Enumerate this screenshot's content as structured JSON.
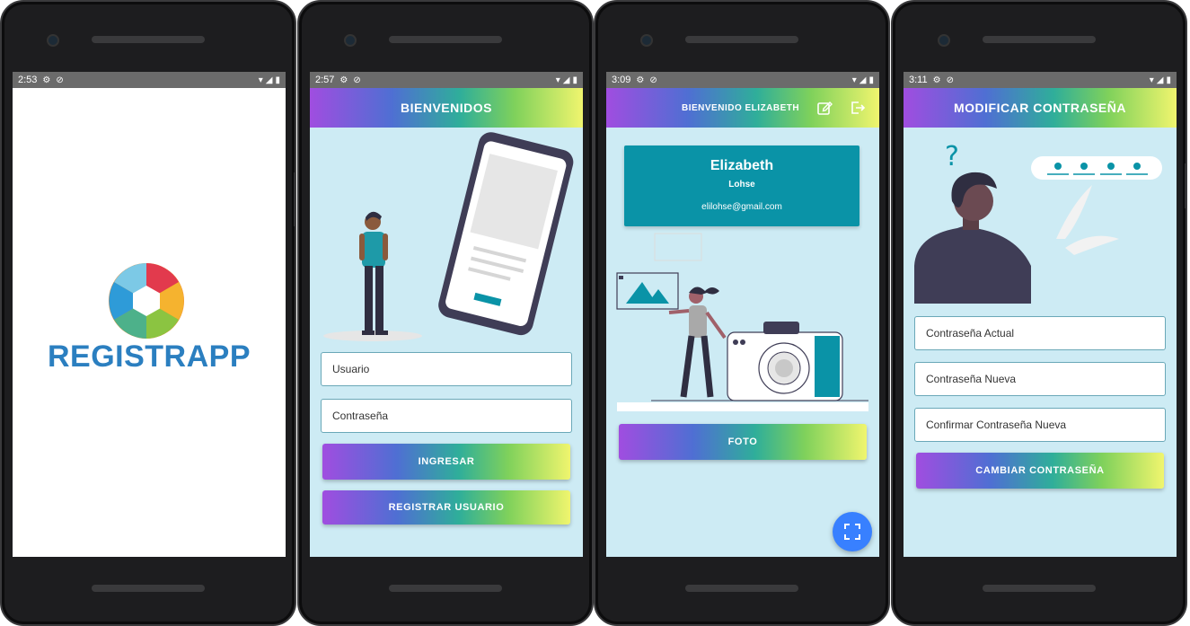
{
  "phone1": {
    "time": "2:53",
    "brand": "REGISTRAPP"
  },
  "phone2": {
    "time": "2:57",
    "title": "BIENVENIDOS",
    "username_placeholder": "Usuario",
    "password_placeholder": "Contraseña",
    "login_label": "INGRESAR",
    "register_label": "REGISTRAR USUARIO"
  },
  "phone3": {
    "time": "3:09",
    "title": "BIENVENIDO ELIZABETH",
    "first_name": "Elizabeth",
    "last_name": "Lohse",
    "email": "elilohse@gmail.com",
    "photo_label": "FOTO"
  },
  "phone4": {
    "time": "3:11",
    "title": "MODIFICAR CONTRASEÑA",
    "current_placeholder": "Contraseña Actual",
    "new_placeholder": "Contraseña Nueva",
    "confirm_placeholder": "Confirmar Contraseña Nueva",
    "change_label": "CAMBIAR CONTRASEÑA"
  },
  "colors": {
    "screen_bg": "#cdebf4",
    "card": "#0a93a7",
    "fab": "#3880ff",
    "gradient": [
      "#a04de0",
      "#4f6fd3",
      "#2fae9a",
      "#7fd15b",
      "#f0f56e"
    ]
  }
}
